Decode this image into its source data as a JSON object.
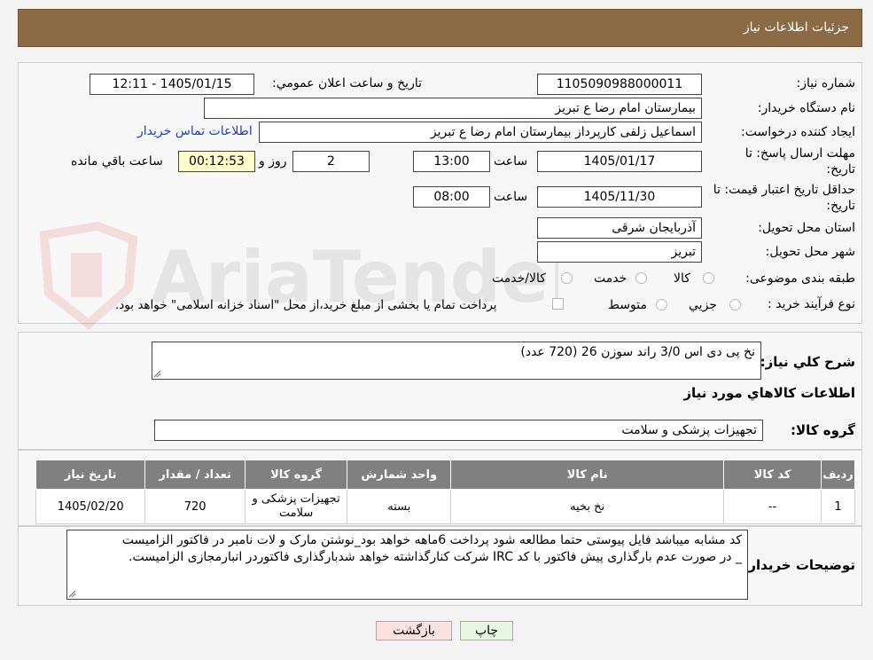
{
  "header": {
    "title": "جزئیات اطلاعات نیاز"
  },
  "form": {
    "need_number_label": "شماره نیاز:",
    "need_number": "1105090988000011",
    "announce_label": "تاریخ و ساعت اعلان عمومي:",
    "announce_value": "1405/01/15 - 12:11",
    "buyer_org_label": "نام دستگاه خريدار:",
    "buyer_org": "بیمارستان امام رضا  ع  تبریز",
    "creator_label": "ايجاد کننده درخواست:",
    "creator": "اسماعیل زلفی کارپرداز بیمارستان امام رضا  ع  تبریز",
    "contact_link": "اطلاعات تماس خریدار",
    "deadline_label_1": "مهلت ارسال پاسخ: تا",
    "deadline_label_2": "تاريخ:",
    "deadline_date": "1405/01/17",
    "time_label": "ساعت",
    "deadline_time": "13:00",
    "days_value": "2",
    "days_label": "روز و",
    "remaining_time": "00:12:53",
    "remaining_label": "ساعت باقي مانده",
    "validity_label_1": "حداقل تاريخ اعتبار قيمت: تا",
    "validity_label_2": "تاريخ:",
    "validity_date": "1405/11/30",
    "validity_time": "08:00",
    "province_label": "استان محل تحويل:",
    "province": "آذربایجان شرقی",
    "city_label": "شهر محل تحويل:",
    "city": "تبریز",
    "category_label": "طبقه بندی موضوعی:",
    "category_options": [
      "کالا",
      "خدمت",
      "کالا/خدمت"
    ],
    "process_label": "نوع فرآيند خريد :",
    "process_options": [
      "جزيي",
      "متوسط"
    ],
    "payment_note": "پرداخت تمام يا بخشی از مبلغ خريد،از محل \"اسناد خزانه اسلامی\" خواهد بود."
  },
  "description": {
    "label": "شرح کلي نياز:",
    "value": "نخ پی دی اس 3/0 راند سوزن 26 (720 عدد)"
  },
  "goods": {
    "section_title": "اطلاعات کالاهاي مورد نياز",
    "group_label": "گروه کالا:",
    "group_value": "تجهیزات پزشکی و سلامت"
  },
  "table": {
    "headers": [
      "رديف",
      "کد کالا",
      "نام کالا",
      "واحد شمارش",
      "گروه کالا",
      "تعداد / مقدار",
      "تاريخ نياز"
    ],
    "rows": [
      {
        "row": "1",
        "code": "--",
        "name": "نخ بخیه",
        "unit": "بسته",
        "group": "تجهیزات پزشکی و سلامت",
        "qty": "720",
        "date": "1405/02/20"
      }
    ]
  },
  "buyer_notes": {
    "label": "توضيحات خريدار:",
    "line1": "کد مشابه میباشد فایل پیوستی حتما مطالعه شود  پرداخت 6ماهه خواهد بود_نوشتن مارک و لات نامبر در فاکتور الزامیست",
    "line2": "_  در صورت عدم بارگذاری پیش فاکتور با کد IRC  شرکت کنارگذاشته خواهد شدبارگذاری فاکتوردر انبارمجازی الزامیست."
  },
  "buttons": {
    "print": "چاپ",
    "back": "بازگشت"
  },
  "watermark_text": "AriaTender.neT"
}
